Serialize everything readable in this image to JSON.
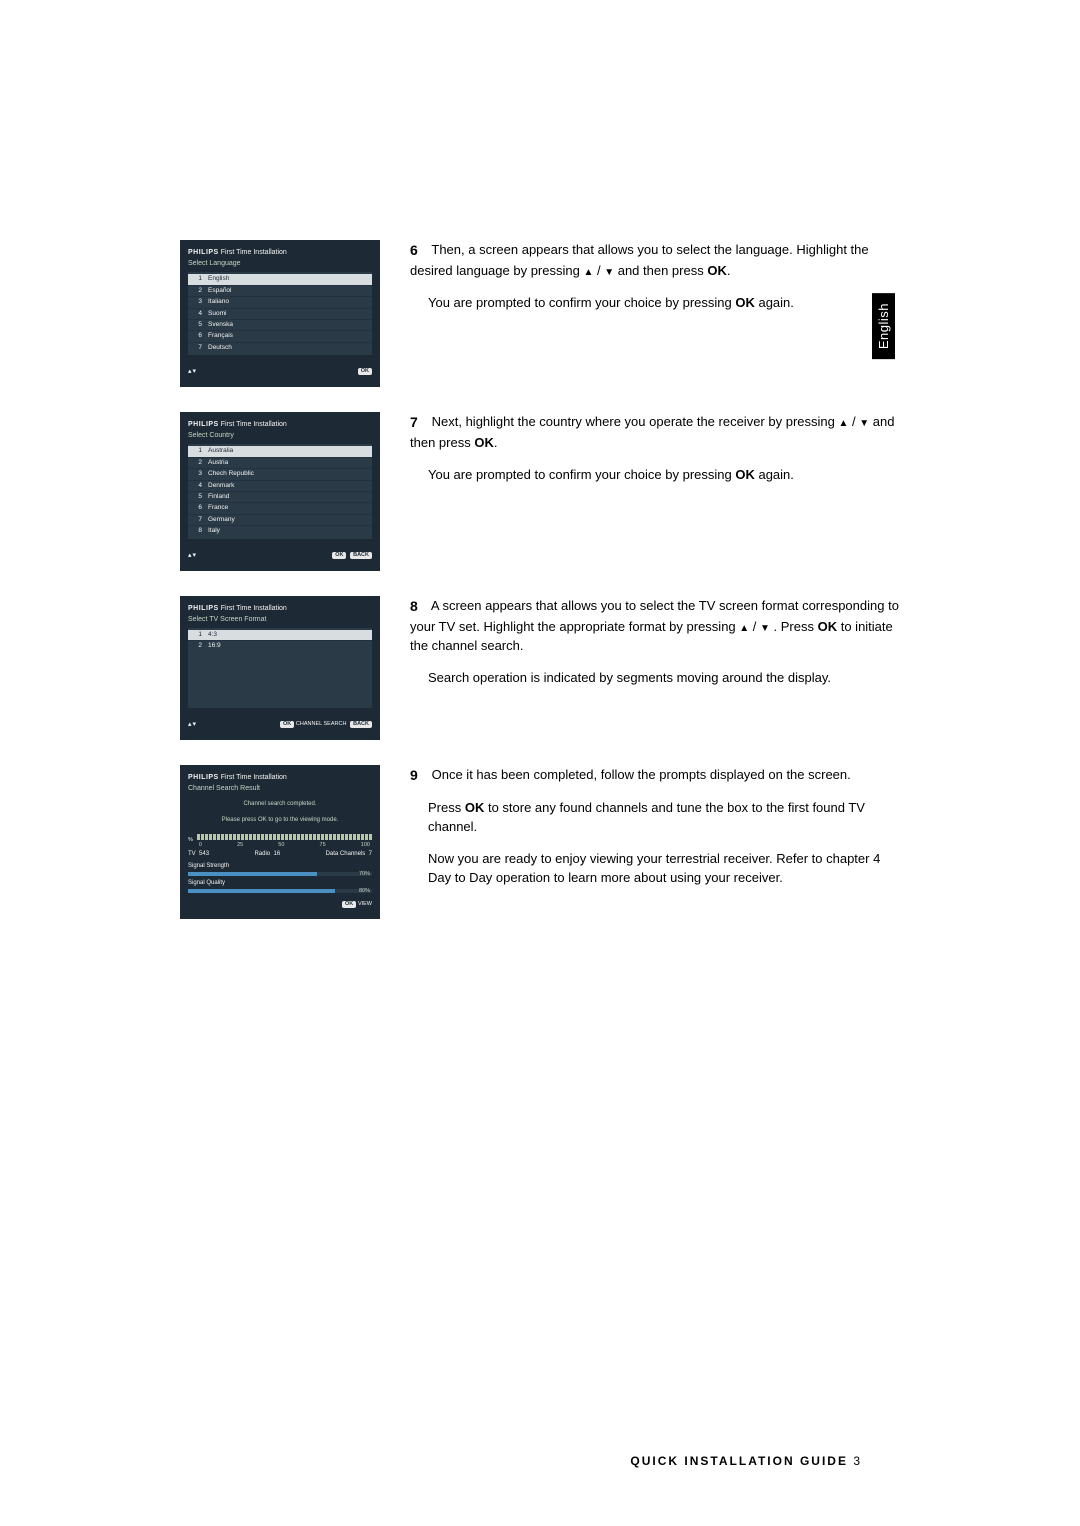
{
  "sidebar_label": "English",
  "footer": {
    "title": "QUICK INSTALLATION GUIDE",
    "page": "3"
  },
  "panels": {
    "lang": {
      "title": "First Time Installation",
      "subtitle": "Select Language",
      "items": [
        {
          "n": "1",
          "label": "English"
        },
        {
          "n": "2",
          "label": "Español"
        },
        {
          "n": "3",
          "label": "Italiano"
        },
        {
          "n": "4",
          "label": "Suomi"
        },
        {
          "n": "5",
          "label": "Svenska"
        },
        {
          "n": "6",
          "label": "Français"
        },
        {
          "n": "7",
          "label": "Deutsch"
        }
      ],
      "footer_right": "OK"
    },
    "country": {
      "title": "First Time Installation",
      "subtitle": "Select Country",
      "items": [
        {
          "n": "1",
          "label": "Australia"
        },
        {
          "n": "2",
          "label": "Austria"
        },
        {
          "n": "3",
          "label": "Chech Republic"
        },
        {
          "n": "4",
          "label": "Denmark"
        },
        {
          "n": "5",
          "label": "Finland"
        },
        {
          "n": "6",
          "label": "France"
        },
        {
          "n": "7",
          "label": "Germany"
        },
        {
          "n": "8",
          "label": "Italy"
        }
      ],
      "footer_ok": "OK",
      "footer_back": "BACK"
    },
    "format": {
      "title": "First Time Installation",
      "subtitle": "Select TV Screen Format",
      "items": [
        {
          "n": "1",
          "label": "4:3"
        },
        {
          "n": "2",
          "label": "16:9"
        }
      ],
      "footer_ok": "OK",
      "footer_search": "CHANNEL SEARCH",
      "footer_back": "BACK"
    },
    "result": {
      "title": "First Time Installation",
      "subtitle": "Channel Search Result",
      "msg1": "Channel search completed.",
      "msg2": "Please press OK to go to the viewing mode.",
      "scale_pct": "%",
      "scale": [
        "0",
        "25",
        "50",
        "75",
        "100"
      ],
      "tv_label": "TV",
      "tv_val": "543",
      "radio_label": "Radio",
      "radio_val": "16",
      "data_label": "Data Channels",
      "data_val": "7",
      "strength_label": "Signal Strength",
      "strength_pct": "70%",
      "strength_w": "70%",
      "quality_label": "Signal Quality",
      "quality_pct": "80%",
      "quality_w": "80%",
      "footer_ok": "OK",
      "footer_view": "VIEW"
    }
  },
  "steps": {
    "s6": {
      "num": "6",
      "p1a": "Then, a screen appears that allows you to select the language. Highlight the desired language by pressing ",
      "p1b": " and then press ",
      "ok": "OK",
      "p1c": ".",
      "p2a": "You are prompted to confirm your choice by pressing ",
      "p2b": " again."
    },
    "s7": {
      "num": "7",
      "p1a": "Next, highlight the country where you operate the receiver by pressing ",
      "p1b": " and then press ",
      "ok": "OK",
      "p1c": ".",
      "p2a": "You are prompted to confirm your choice by pressing ",
      "p2b": " again."
    },
    "s8": {
      "num": "8",
      "p1a": "A screen appears that allows you to select the TV screen format corresponding to your TV set. Highlight the appropriate format by pressing ",
      "p1b": " . Press ",
      "ok": "OK",
      "p1c": " to initiate the channel search.",
      "p2": "Search operation is indicated by segments moving around the display."
    },
    "s9": {
      "num": "9",
      "p1": "Once it has been completed, follow the prompts displayed on the screen.",
      "p2a": "Press ",
      "ok": "OK",
      "p2b": " to store any found channels and tune the box to the first found TV channel.",
      "p3": "Now you are ready to enjoy viewing your terrestrial receiver. Refer to chapter 4 Day to Day operation to learn more about using your receiver."
    }
  },
  "brand": "PHILIPS"
}
